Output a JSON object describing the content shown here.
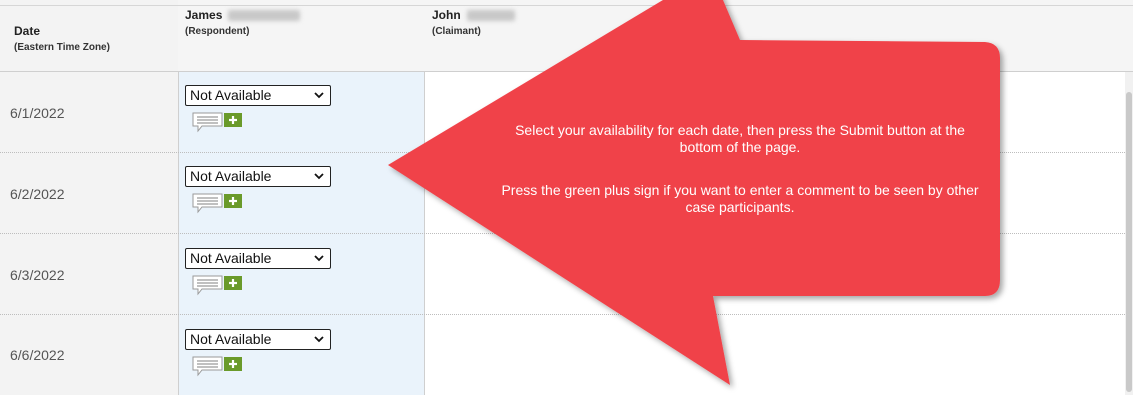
{
  "header": {
    "date_title": "Date",
    "date_sub": "(Eastern Time Zone)",
    "respondent_name": "James",
    "respondent_role": "(Respondent)",
    "claimant_name": "John",
    "claimant_role": "(Claimant)"
  },
  "rows": [
    {
      "date": "6/1/2022",
      "availability": "Not Available"
    },
    {
      "date": "6/2/2022",
      "availability": "Not Available"
    },
    {
      "date": "6/3/2022",
      "availability": "Not Available"
    },
    {
      "date": "6/6/2022",
      "availability": "Not Available"
    }
  ],
  "callout": {
    "line1": "Select your availability for each date, then press the Submit button at the bottom of the page.",
    "line2": "Press the green plus sign if you want to enter a comment to be seen by other case participants."
  },
  "colors": {
    "arrow": "#f0434a",
    "comment_plus": "#6a9a2a",
    "respondent_column": "#eaf3fb"
  },
  "icons": {
    "select_chevron": "chevron-down-icon",
    "comment": "comment-add-icon"
  }
}
